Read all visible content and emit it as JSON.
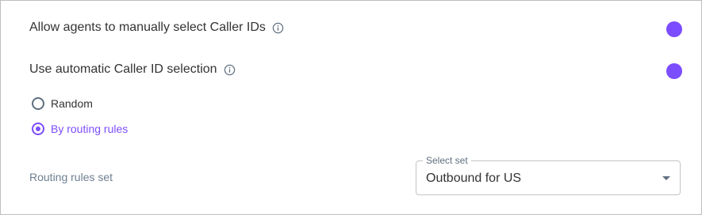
{
  "settings": {
    "manual_selection": {
      "label": "Allow agents to manually select Caller IDs",
      "icon": "info-icon",
      "enabled": true
    },
    "automatic_selection": {
      "label": "Use automatic Caller ID selection",
      "icon": "info-icon",
      "enabled": true
    },
    "selection_mode": {
      "options": [
        {
          "label": "Random",
          "selected": false
        },
        {
          "label": "By routing rules",
          "selected": true
        }
      ]
    },
    "routing_rules_set": {
      "label": "Routing rules set",
      "select_legend": "Select set",
      "select_value": "Outbound for US",
      "caret_icon": "caret-down-icon"
    }
  },
  "colors": {
    "accent": "#7c4dff",
    "text": "#333333",
    "muted": "#6e7f91",
    "border": "#c4c4c4"
  }
}
